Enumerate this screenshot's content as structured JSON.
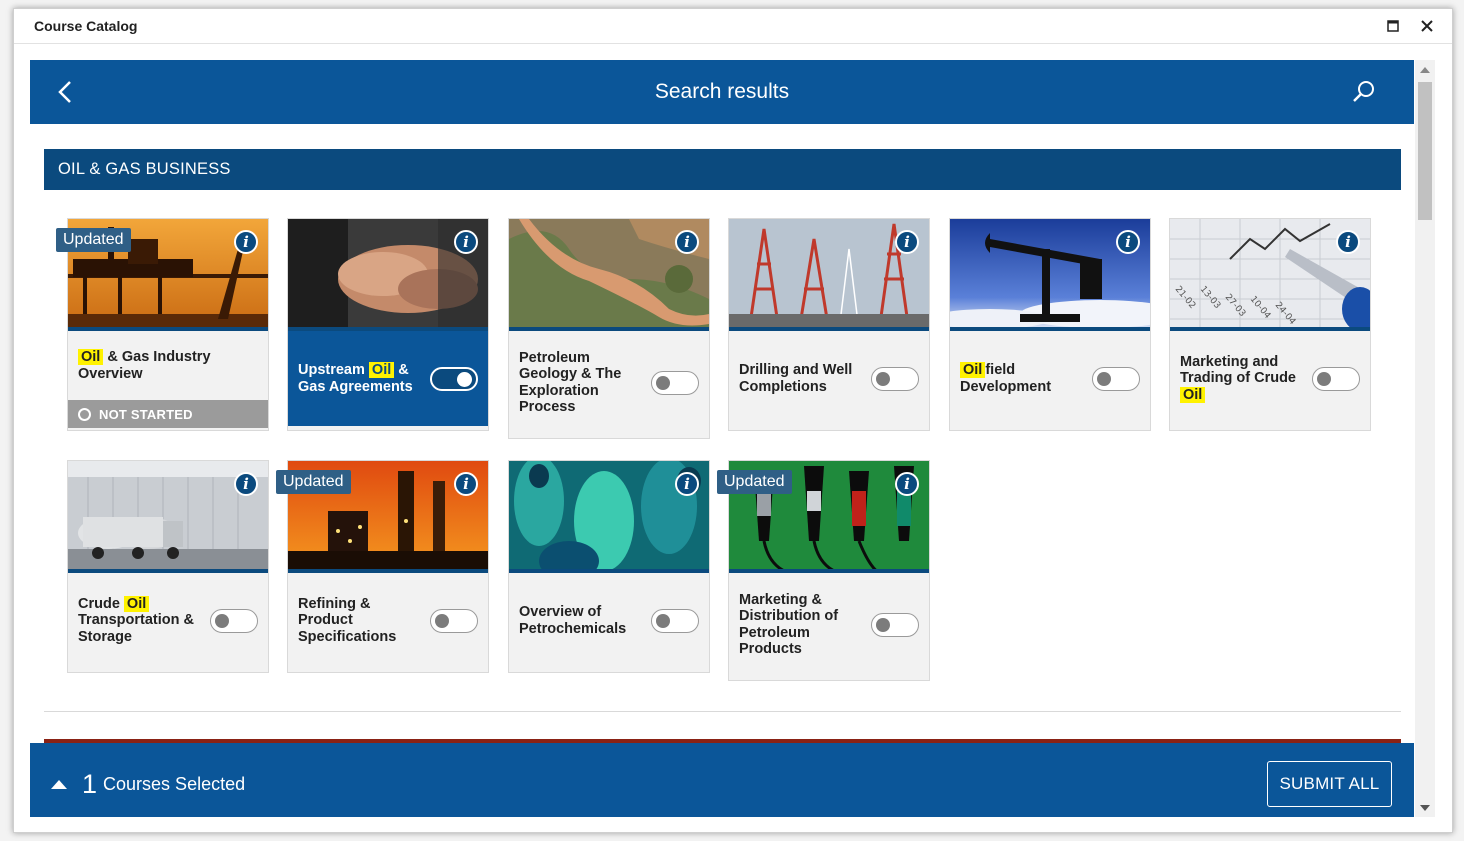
{
  "window": {
    "title": "Course Catalog"
  },
  "header": {
    "title": "Search results"
  },
  "category": {
    "name": "OIL & GAS BUSINESS"
  },
  "badges": {
    "updated": "Updated"
  },
  "status": {
    "not_started": "NOT STARTED"
  },
  "courses": [
    {
      "title_pre": "",
      "highlight": "Oil",
      "title_post": " & Gas Industry Overview",
      "updated": true,
      "selected": false,
      "status": "NOT STARTED",
      "image": "oil-rig-sunset"
    },
    {
      "title_pre": "Upstream ",
      "highlight": "Oil",
      "title_post": " & Gas Agreements",
      "updated": false,
      "selected": true,
      "image": "handshake"
    },
    {
      "title_pre": "Petroleum Geology & The Exploration Process",
      "highlight": "",
      "title_post": "",
      "updated": false,
      "selected": false,
      "image": "river-canyon-aerial"
    },
    {
      "title_pre": "Drilling and Well Completions",
      "highlight": "",
      "title_post": "",
      "updated": false,
      "selected": false,
      "image": "drilling-towers"
    },
    {
      "title_pre": "",
      "highlight": "Oil",
      "title_post": "field Development",
      "updated": false,
      "selected": false,
      "image": "pumpjack"
    },
    {
      "title_pre": "Marketing and Trading of Crude ",
      "highlight": "Oil",
      "title_post": "",
      "updated": false,
      "selected": false,
      "image": "stock-chart-pen"
    },
    {
      "title_pre": "Crude ",
      "highlight": "Oil",
      "title_post": " Transportation & Storage",
      "updated": false,
      "selected": false,
      "image": "tanker-truck"
    },
    {
      "title_pre": "Refining & Product Specifications",
      "highlight": "",
      "title_post": "",
      "updated": true,
      "selected": false,
      "image": "refinery"
    },
    {
      "title_pre": "Overview of Petrochemicals",
      "highlight": "",
      "title_post": "",
      "updated": false,
      "selected": false,
      "image": "plastic-bottles"
    },
    {
      "title_pre": "Marketing & Distribution of Petroleum Products",
      "highlight": "",
      "title_post": "",
      "updated": true,
      "selected": false,
      "image": "fuel-pumps"
    }
  ],
  "footer": {
    "count": "1",
    "label": "Courses Selected",
    "submit_label": "SUBMIT ALL"
  },
  "colors": {
    "header_blue": "#0b5699",
    "category_blue": "#0b4a7e",
    "highlight": "#fff200",
    "next_category": "#8a2215"
  }
}
